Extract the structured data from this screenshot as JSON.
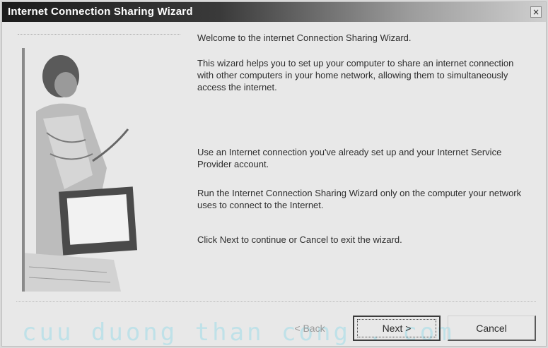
{
  "window": {
    "title": "Internet Connection Sharing Wizard",
    "close_glyph": "×"
  },
  "content": {
    "paragraphs": [
      "Welcome to the internet Connection Sharing Wizard.",
      "This wizard helps you to set up your computer to share an internet connection with other computers in your home network, allowing them to simultaneously access the internet.",
      "Use an Internet connection you've already set up and your Internet Service Provider account.",
      "Run the Internet Connection Sharing Wizard only on the computer your network uses to connect to the Internet.",
      "Click Next to continue or Cancel to exit the wizard."
    ]
  },
  "buttons": {
    "back": "< Back",
    "next": "Next >",
    "cancel": "Cancel"
  },
  "watermark": "cuu duong than cong . com",
  "icons": [
    "close-icon",
    "computer-user-illustration"
  ],
  "colors": {
    "title_gradient_start": "#1c1c1c",
    "title_text": "#ffffff",
    "watermark": "#bfe1e8"
  }
}
